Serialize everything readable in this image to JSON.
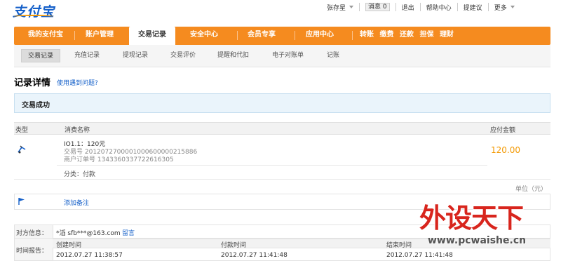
{
  "logo": {
    "text": "支付宝"
  },
  "toplinks": {
    "user": "张存星",
    "messages_label": "消息",
    "messages_count": "0",
    "logout": "退出",
    "help_center": "帮助中心",
    "suggest": "提建议",
    "more": "更多"
  },
  "mainnav": {
    "items": [
      "我的支付宝",
      "账户管理",
      "交易记录",
      "安全中心",
      "会员专享",
      "应用中心"
    ],
    "active": "交易记录",
    "quick": [
      "转账",
      "缴费",
      "还款",
      "担保",
      "理财"
    ]
  },
  "subnav": {
    "items": [
      "交易记录",
      "充值记录",
      "提现记录",
      "交易评价",
      "提醒和代扣",
      "电子对账单",
      "记账"
    ]
  },
  "page": {
    "title": "记录详情",
    "help_link": "使用遇到问题?"
  },
  "status": {
    "text": "交易成功"
  },
  "table": {
    "headers": {
      "type": "类型",
      "name": "消费名称",
      "amount": "应付金额"
    },
    "row": {
      "item": "IO1.1：120元",
      "trade_no": "交易号 2012072700001000600000215886",
      "merchant_order": "商户订单号 1343360337722616305",
      "category": "分类：付款",
      "amount": "120.00"
    },
    "unit": "单位（元）"
  },
  "note": {
    "add": "添加备注"
  },
  "counterparty": {
    "label": "对方信息：",
    "value": "*滔 sfb***@163.com",
    "message_link": "留言"
  },
  "times": {
    "label": "时间报告：",
    "headers": [
      "创建时间",
      "付款时间",
      "结束时间"
    ],
    "values": [
      "2012.07.27 11:38:57",
      "2012.07.27 11:41:48",
      "2012.07.27 11:41:48"
    ]
  },
  "watermark": {
    "text": "外设天下",
    "url": "www.pcwaishe.cn"
  },
  "colors": {
    "nav": "#f58b1f",
    "link": "#1560c9",
    "amount": "#f39800",
    "watermark": "#d8251d"
  }
}
